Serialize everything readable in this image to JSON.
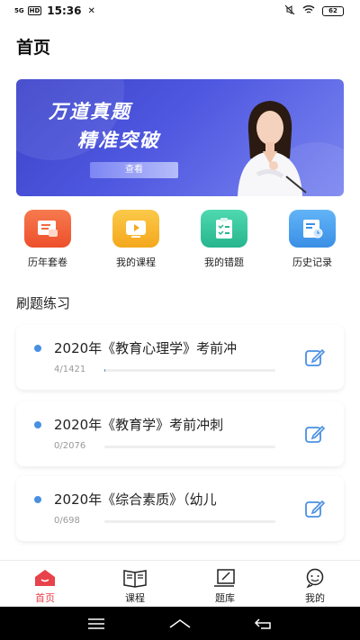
{
  "status_bar": {
    "signal": "5G",
    "hd": "HD",
    "time": "15:36",
    "battery": "62"
  },
  "page": {
    "title": "首页"
  },
  "banner": {
    "line1": "万道真题",
    "line2": "精准突破",
    "button": "查看"
  },
  "quick_menu": [
    {
      "label": "历年套卷",
      "icon": "document-icon",
      "color": "#f0623c"
    },
    {
      "label": "我的课程",
      "icon": "video-play-icon",
      "color": "#f7b52a"
    },
    {
      "label": "我的错题",
      "icon": "checklist-icon",
      "color": "#37c8a0"
    },
    {
      "label": "历史记录",
      "icon": "history-icon",
      "color": "#4a9cf0"
    }
  ],
  "section": {
    "title": "刷题练习"
  },
  "practice": [
    {
      "title": "2020年《教育心理学》考前冲",
      "progress_text": "4/1421",
      "progress": 0.003
    },
    {
      "title": "2020年《教育学》考前冲刺",
      "progress_text": "0/2076",
      "progress": 0
    },
    {
      "title": "2020年《综合素质》（幼儿",
      "progress_text": "0/698",
      "progress": 0
    }
  ],
  "bottom_nav": [
    {
      "label": "首页",
      "icon": "home-icon",
      "active": true
    },
    {
      "label": "课程",
      "icon": "book-icon",
      "active": false
    },
    {
      "label": "题库",
      "icon": "question-bank-icon",
      "active": false
    },
    {
      "label": "我的",
      "icon": "profile-icon",
      "active": false
    }
  ],
  "colors": {
    "accent": "#e8424a",
    "blue": "#4a90e2",
    "banner": "#4f58e0"
  }
}
